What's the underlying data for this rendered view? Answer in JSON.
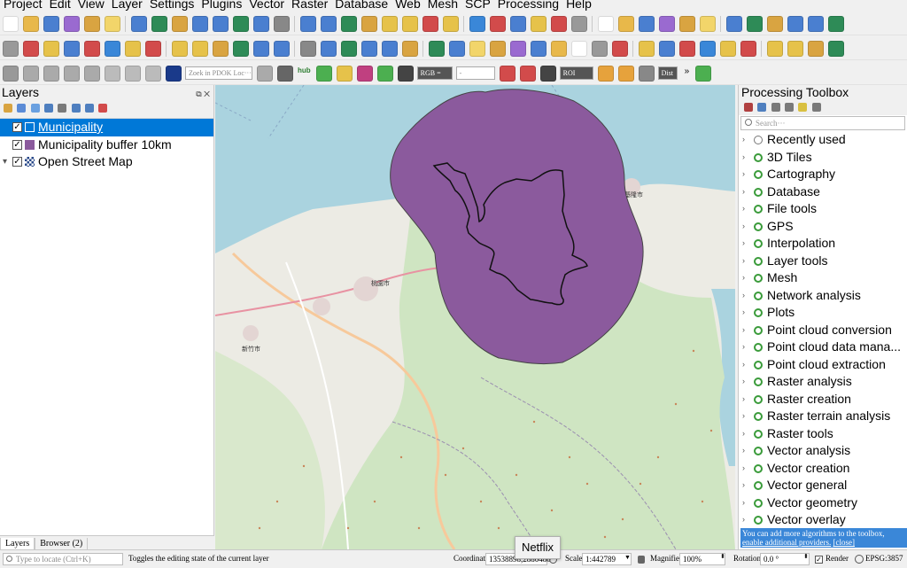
{
  "menu": [
    "Project",
    "Edit",
    "View",
    "Layer",
    "Settings",
    "Plugins",
    "Vector",
    "Raster",
    "Database",
    "Web",
    "Mesh",
    "SCP",
    "Processing",
    "Help"
  ],
  "toolbar3": {
    "locator_placeholder": "Zoek in PDOK Loc···",
    "hub_label": "hub",
    "rgb_label": "RGB =",
    "rgb_value": "-",
    "roi_label": "ROI",
    "dist_label": "Dist"
  },
  "layers_panel": {
    "title": "Layers",
    "items": [
      {
        "label": "Municipality",
        "selected": true,
        "swatch_color": "#0078d7"
      },
      {
        "label": "Municipality buffer 10km",
        "selected": false,
        "swatch_color": "#8b5a9d"
      },
      {
        "label": "Open Street Map",
        "selected": false
      }
    ],
    "tabs": [
      "Layers",
      "Browser (2)"
    ]
  },
  "map": {
    "buffer_fill": "#8b5a9d",
    "water_color": "#aad3df",
    "land_color": "#ecebe4",
    "place_labels": [
      "桃園市",
      "基隆市",
      "新竹市"
    ]
  },
  "toolbox": {
    "title": "Processing Toolbox",
    "search_placeholder": "Search···",
    "items": [
      {
        "label": "Recently used",
        "icon": "clock-icon"
      },
      {
        "label": "3D Tiles",
        "icon": "qgis-icon"
      },
      {
        "label": "Cartography",
        "icon": "qgis-icon"
      },
      {
        "label": "Database",
        "icon": "qgis-icon"
      },
      {
        "label": "File tools",
        "icon": "qgis-icon"
      },
      {
        "label": "GPS",
        "icon": "qgis-icon"
      },
      {
        "label": "Interpolation",
        "icon": "qgis-icon"
      },
      {
        "label": "Layer tools",
        "icon": "qgis-icon"
      },
      {
        "label": "Mesh",
        "icon": "qgis-icon"
      },
      {
        "label": "Network analysis",
        "icon": "qgis-icon"
      },
      {
        "label": "Plots",
        "icon": "qgis-icon"
      },
      {
        "label": "Point cloud conversion",
        "icon": "qgis-icon"
      },
      {
        "label": "Point cloud data mana...",
        "icon": "qgis-icon"
      },
      {
        "label": "Point cloud extraction",
        "icon": "qgis-icon"
      },
      {
        "label": "Raster analysis",
        "icon": "qgis-icon"
      },
      {
        "label": "Raster creation",
        "icon": "qgis-icon"
      },
      {
        "label": "Raster terrain analysis",
        "icon": "qgis-icon"
      },
      {
        "label": "Raster tools",
        "icon": "qgis-icon"
      },
      {
        "label": "Vector analysis",
        "icon": "qgis-icon"
      },
      {
        "label": "Vector creation",
        "icon": "qgis-icon"
      },
      {
        "label": "Vector general",
        "icon": "qgis-icon"
      },
      {
        "label": "Vector geometry",
        "icon": "qgis-icon"
      },
      {
        "label": "Vector overlay",
        "icon": "qgis-icon"
      }
    ],
    "message": "You can add more algorithms to the toolbox,",
    "message_link": "enable additional providers.",
    "message_close": "[close]"
  },
  "statusbar": {
    "locate_placeholder": "Type to locate (Ctrl+K)",
    "hint": "Toggles the editing state of the current layer",
    "coordinate_label": "Coordinate",
    "coordinate_value": "13538898,2880480",
    "scale_label": "Scale",
    "scale_value": "1:442789",
    "magnifier_label": "Magnifier",
    "magnifier_value": "100%",
    "rotation_label": "Rotation",
    "rotation_value": "0.0 °",
    "render_label": "Render",
    "crs_label": "EPSG:3857"
  },
  "tooltip": "Netflix"
}
